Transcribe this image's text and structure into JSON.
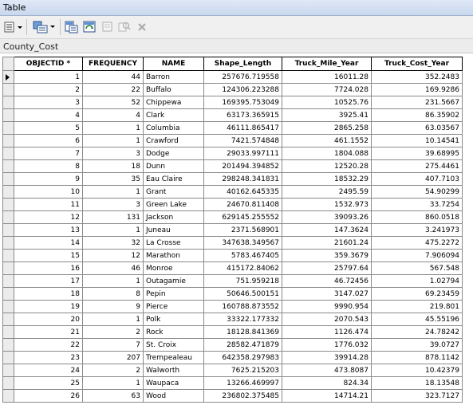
{
  "window": {
    "title": "Table"
  },
  "toolbar": {
    "buttons": [
      {
        "name": "table-options-icon"
      },
      {
        "name": "related-tables-icon"
      },
      {
        "name": "select-by-attributes-icon"
      },
      {
        "name": "switch-selection-icon"
      },
      {
        "name": "clear-selection-icon"
      },
      {
        "name": "zoom-to-selected-icon"
      },
      {
        "name": "delete-selected-icon"
      }
    ]
  },
  "table_name": "County_Cost",
  "columns": [
    "OBJECTID *",
    "FREQUENCY",
    "NAME",
    "Shape_Length",
    "Truck_Mile_Year",
    "Truck_Cost_Year"
  ],
  "rows": [
    [
      "1",
      "44",
      "Barron",
      "257676.719558",
      "16011.28",
      "352.2483"
    ],
    [
      "2",
      "22",
      "Buffalo",
      "124306.223288",
      "7724.028",
      "169.9286"
    ],
    [
      "3",
      "52",
      "Chippewa",
      "169395.753049",
      "10525.76",
      "231.5667"
    ],
    [
      "4",
      "4",
      "Clark",
      "63173.365915",
      "3925.41",
      "86.35902"
    ],
    [
      "5",
      "1",
      "Columbia",
      "46111.865417",
      "2865.258",
      "63.03567"
    ],
    [
      "6",
      "1",
      "Crawford",
      "7421.574848",
      "461.1552",
      "10.14541"
    ],
    [
      "7",
      "3",
      "Dodge",
      "29033.997111",
      "1804.088",
      "39.68995"
    ],
    [
      "8",
      "18",
      "Dunn",
      "201494.394852",
      "12520.28",
      "275.4461"
    ],
    [
      "9",
      "35",
      "Eau Claire",
      "298248.341831",
      "18532.29",
      "407.7103"
    ],
    [
      "10",
      "1",
      "Grant",
      "40162.645335",
      "2495.59",
      "54.90299"
    ],
    [
      "11",
      "3",
      "Green Lake",
      "24670.811408",
      "1532.973",
      "33.7254"
    ],
    [
      "12",
      "131",
      "Jackson",
      "629145.255552",
      "39093.26",
      "860.0518"
    ],
    [
      "13",
      "1",
      "Juneau",
      "2371.568901",
      "147.3624",
      "3.241973"
    ],
    [
      "14",
      "32",
      "La Crosse",
      "347638.349567",
      "21601.24",
      "475.2272"
    ],
    [
      "15",
      "12",
      "Marathon",
      "5783.467405",
      "359.3679",
      "7.906094"
    ],
    [
      "16",
      "46",
      "Monroe",
      "415172.84062",
      "25797.64",
      "567.548"
    ],
    [
      "17",
      "1",
      "Outagamie",
      "751.959218",
      "46.72456",
      "1.02794"
    ],
    [
      "18",
      "8",
      "Pepin",
      "50646.500151",
      "3147.027",
      "69.23459"
    ],
    [
      "19",
      "9",
      "Pierce",
      "160788.873552",
      "9990.954",
      "219.801"
    ],
    [
      "20",
      "1",
      "Polk",
      "33322.177332",
      "2070.543",
      "45.55196"
    ],
    [
      "21",
      "2",
      "Rock",
      "18128.841369",
      "1126.474",
      "24.78242"
    ],
    [
      "22",
      "7",
      "St. Croix",
      "28582.471879",
      "1776.032",
      "39.0727"
    ],
    [
      "23",
      "207",
      "Trempealeau",
      "642358.297983",
      "39914.28",
      "878.1142"
    ],
    [
      "24",
      "2",
      "Walworth",
      "7625.215203",
      "473.8087",
      "10.42379"
    ],
    [
      "25",
      "1",
      "Waupaca",
      "13266.469997",
      "824.34",
      "18.13548"
    ],
    [
      "26",
      "63",
      "Wood",
      "236802.375485",
      "14714.21",
      "323.7127"
    ]
  ]
}
